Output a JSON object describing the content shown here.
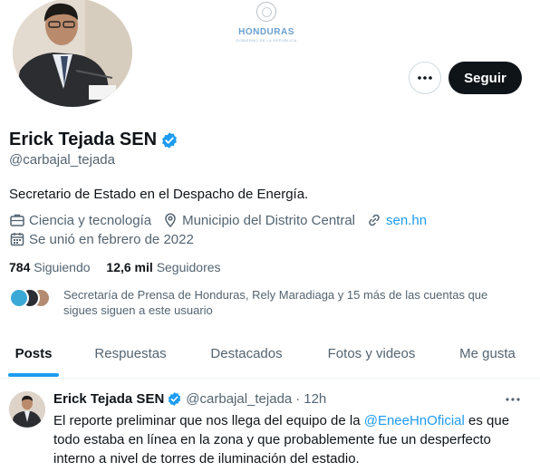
{
  "banner": {
    "org_name": "HONDURAS",
    "org_subtitle": "GOBIERNO DE LA REPÚBLICA"
  },
  "profile": {
    "name": "Erick Tejada SEN",
    "handle": "@carbajal_tejada",
    "bio": "Secretario de Estado en el Despacho de Energía.",
    "category": "Ciencia y tecnología",
    "location": "Municipio del Distrito Central",
    "website": "sen.hn",
    "joined": "Se unió en febrero de 2022",
    "following_count": "784",
    "following_label": "Siguiendo",
    "followers_count": "12,6 mil",
    "followers_label": "Seguidores",
    "followers_you_know": "Secretaría de Prensa de Honduras, Rely Maradiaga y 15 más de las cuentas que sigues siguen a este usuario"
  },
  "actions": {
    "follow_label": "Seguir",
    "more_icon": "more-horizontal-icon"
  },
  "tabs": [
    {
      "label": "Posts",
      "active": true
    },
    {
      "label": "Respuestas",
      "active": false
    },
    {
      "label": "Destacados",
      "active": false
    },
    {
      "label": "Fotos y videos",
      "active": false
    },
    {
      "label": "Me gusta",
      "active": false
    }
  ],
  "tweet": {
    "name": "Erick Tejada SEN",
    "handle": "@carbajal_tejada",
    "separator": "·",
    "time": "12h",
    "text_before": "El  reporte preliminar que nos llega del equipo de la ",
    "mention": "@EneeHnOficial",
    "text_after": " es que todo estaba en línea en la zona y que probablemente  fue un desperfecto interno a nivel de torres de iluminación del estadio."
  },
  "colors": {
    "accent": "#1d9bf0",
    "text": "#0f1419",
    "muted": "#536471",
    "button": "#0f1419"
  }
}
